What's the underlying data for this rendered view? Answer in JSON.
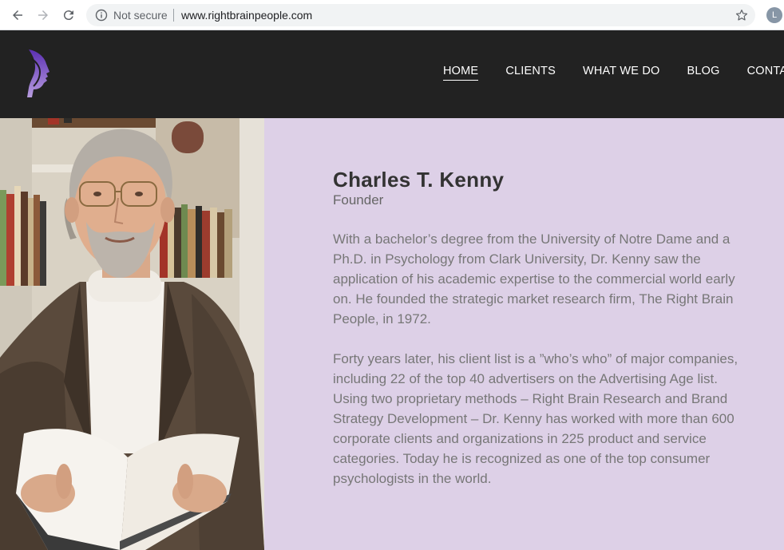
{
  "browser": {
    "security_label": "Not secure",
    "url": "www.rightbrainpeople.com",
    "profile_initial": "L",
    "icons": [
      "back-icon",
      "forward-icon",
      "reload-icon",
      "info-icon",
      "star-icon"
    ]
  },
  "nav": {
    "items": [
      {
        "label": "HOME",
        "active": true
      },
      {
        "label": "CLIENTS",
        "active": false
      },
      {
        "label": "WHAT WE DO",
        "active": false
      },
      {
        "label": "BLOG",
        "active": false
      },
      {
        "label": "CONTACT",
        "active": false
      }
    ]
  },
  "bio": {
    "name": "Charles T. Kenny",
    "role": "Founder",
    "paragraphs": [
      "With a bachelor’s degree from the University of Notre Dame and a Ph.D. in Psychology from Clark University, Dr. Kenny saw the application of his academic expertise to the commercial world early on. He founded the strategic market research firm, The Right Brain People, in 1972.",
      "Forty years later, his client list is a ”who’s who” of major companies, including 22 of the top 40 advertisers on the Advertising Age list. Using two proprietary methods – Right Brain Research and Brand Strategy Development – Dr. Kenny has worked with more than 600 corporate clients and organizations in 225 product and service categories. Today he is recognized as one of the top consumer psychologists in the world."
    ]
  },
  "colors": {
    "header_bg": "#222222",
    "panel_bg": "#ddd0e7",
    "logo_purple": "#7b4fc9"
  }
}
